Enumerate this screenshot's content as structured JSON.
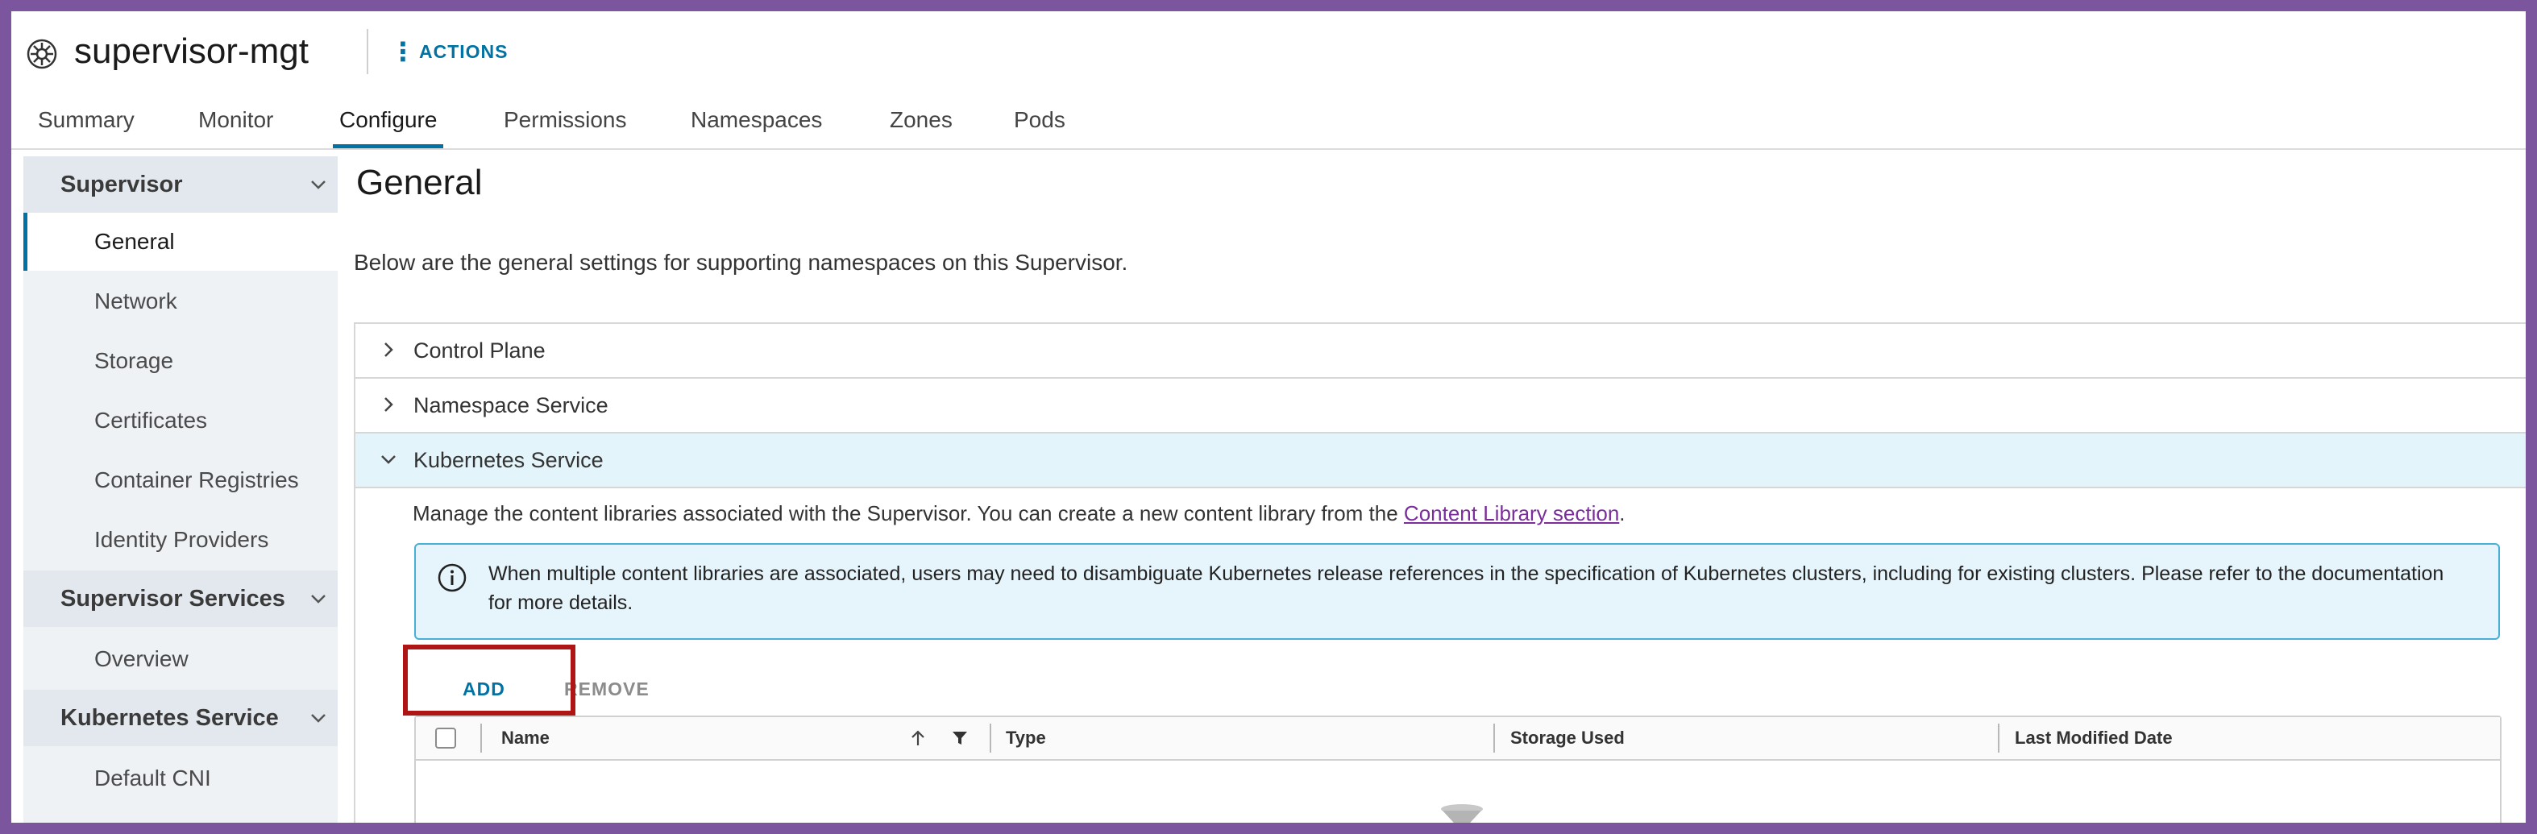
{
  "header": {
    "object_icon": "kubernetes-helm-icon",
    "title": "supervisor-mgt",
    "actions_label": "ACTIONS",
    "actions_icon": "vertical-ellipsis-icon"
  },
  "tabs": [
    {
      "label": "Summary"
    },
    {
      "label": "Monitor"
    },
    {
      "label": "Configure"
    },
    {
      "label": "Permissions"
    },
    {
      "label": "Namespaces"
    },
    {
      "label": "Zones"
    },
    {
      "label": "Pods"
    }
  ],
  "active_tab": "Configure",
  "sidebar": {
    "groups": [
      {
        "label": "Supervisor",
        "items": [
          "General",
          "Network",
          "Storage",
          "Certificates",
          "Container Registries",
          "Identity Providers"
        ]
      },
      {
        "label": "Supervisor Services",
        "items": [
          "Overview"
        ]
      },
      {
        "label": "Kubernetes Service",
        "items": [
          "Default CNI"
        ]
      }
    ],
    "active_item": "General"
  },
  "main": {
    "title": "General",
    "description": "Below are the general settings for supporting namespaces on this Supervisor.",
    "sections": [
      {
        "label": "Control Plane",
        "expanded": false
      },
      {
        "label": "Namespace Service",
        "expanded": false
      },
      {
        "label": "Kubernetes Service",
        "expanded": true
      }
    ],
    "kubernetes_service": {
      "description_prefix": "Manage the content libraries associated with the Supervisor. You can create a new content library from the ",
      "link_text": "Content Library section",
      "description_suffix": ".",
      "alert_icon": "info-circle-icon",
      "alert_text": "When multiple content libraries are associated, users may need to disambiguate Kubernetes release references in the specification of Kubernetes clusters, including for existing clusters. Please refer to the documentation for more details.",
      "add_label": "ADD",
      "remove_label": "REMOVE",
      "columns": [
        "Name",
        "Type",
        "Storage Used",
        "Last Modified Date"
      ]
    }
  },
  "colors": {
    "accent": "#0072a3",
    "frame": "#7b559e",
    "highlight_box": "#b01515",
    "alert_border": "#49afd9",
    "alert_bg": "#e6f4fb"
  }
}
